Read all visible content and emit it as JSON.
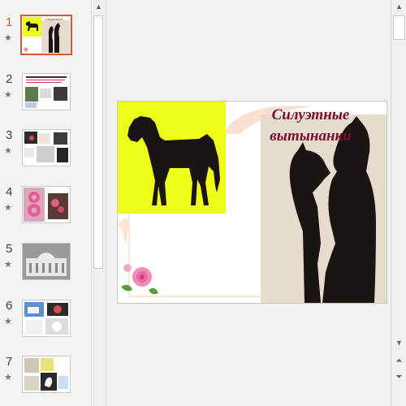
{
  "thumbnails": [
    {
      "number": "1",
      "star": "★"
    },
    {
      "number": "2",
      "star": "★"
    },
    {
      "number": "3",
      "star": "★"
    },
    {
      "number": "4",
      "star": "★"
    },
    {
      "number": "5",
      "star": "★"
    },
    {
      "number": "6",
      "star": "★"
    },
    {
      "number": "7",
      "star": "★"
    }
  ],
  "selected_slide": "1",
  "slide": {
    "title_line1": "Силуэтные",
    "title_line2": "вытынанки"
  },
  "icons": {
    "scroll_up": "triangle-up-icon",
    "scroll_down": "triangle-down-icon",
    "prev_slide": "double-chevron-up-icon",
    "next_slide": "double-chevron-down-icon"
  },
  "colors": {
    "selection": "#d25a35",
    "title": "#7a0f2e",
    "yellow_bg": "#eefe19",
    "silhouette": "#1a1412",
    "beige": "#e6dccd"
  }
}
